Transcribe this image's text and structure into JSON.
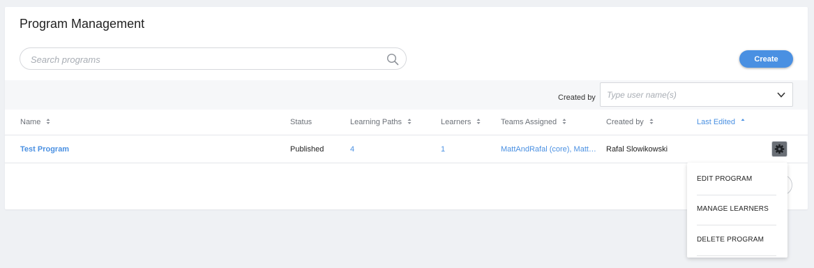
{
  "page": {
    "title": "Program Management"
  },
  "search": {
    "placeholder": "Search programs",
    "value": ""
  },
  "toolbar": {
    "create_label": "Create"
  },
  "filter": {
    "created_by_label": "Created by",
    "user_placeholder": "Type user name(s)"
  },
  "table": {
    "headers": {
      "name": "Name",
      "status": "Status",
      "learning_paths": "Learning Paths",
      "learners": "Learners",
      "teams_assigned": "Teams Assigned",
      "created_by": "Created by",
      "last_edited": "Last Edited"
    },
    "sorted_by": "last_edited",
    "rows": [
      {
        "name": "Test Program",
        "status": "Published",
        "learning_paths": "4",
        "learners": "1",
        "teams_assigned": "MattAndRafal (core), Matt…",
        "created_by": "Rafal Slowikowski",
        "last_edited": ""
      }
    ]
  },
  "menu": {
    "items": [
      "EDIT PROGRAM",
      "MANAGE LEARNERS",
      "DELETE PROGRAM"
    ]
  },
  "colors": {
    "accent": "#4a90e2",
    "background": "#eff1f4",
    "gear_button": "#6a6f76"
  }
}
